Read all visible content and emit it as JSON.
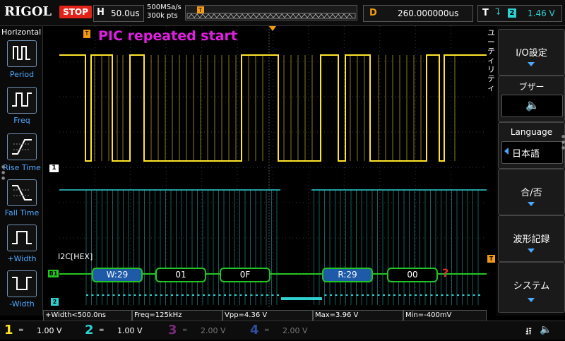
{
  "topbar": {
    "brand": "RIGOL",
    "run_state": "STOP",
    "horizontal_key": "H",
    "timebase": "50.0us",
    "sample_rate": "500MSa/s",
    "memory_depth": "300k pts",
    "delay_key": "D",
    "delay_value": "260.000000us",
    "trigger_key": "T",
    "trigger_source": "2",
    "trigger_level": "1.46 V"
  },
  "left_menu": {
    "title": "Horizontal",
    "items": [
      {
        "label": "Period",
        "icon": "period-icon"
      },
      {
        "label": "Freq",
        "icon": "freq-icon"
      },
      {
        "label": "Rise Time",
        "icon": "rise-time-icon"
      },
      {
        "label": "Fall Time",
        "icon": "fall-time-icon"
      },
      {
        "label": "+Width",
        "icon": "pos-width-icon"
      },
      {
        "label": "-Width",
        "icon": "neg-width-icon"
      }
    ]
  },
  "screen": {
    "annotation": "PIC repeated start",
    "channel_marker_1": "1",
    "bus_marker": "B1",
    "bus_label": "I2C[HEX]",
    "trigger_marker": "T",
    "decode_packets": [
      {
        "text": "W:29",
        "type": "address"
      },
      {
        "text": "01",
        "type": "data"
      },
      {
        "text": "0F",
        "type": "data"
      },
      {
        "text": "R:29",
        "type": "address"
      },
      {
        "text": "00",
        "type": "data"
      }
    ],
    "unknown_mark": "?"
  },
  "utility_tab": "ユーティリティ",
  "right_menu": {
    "io_settings": "I/O設定",
    "buzzer_title": "ブザー",
    "language_title": "Language",
    "language_value": "日本語",
    "pass_fail": "合/否",
    "waveform_record": "波形記録",
    "system": "システム"
  },
  "measurements": {
    "width": "+Width<500.0ns",
    "freq": "Freq=125kHz",
    "vpp": "Vpp=4.36 V",
    "max": "Max=3.96 V",
    "min": "Min=-400mV"
  },
  "channels": [
    {
      "num": "1",
      "coupling": "=",
      "scale": "1.00 V",
      "color": "#ffe42a"
    },
    {
      "num": "2",
      "coupling": "=",
      "scale": "1.00 V",
      "color": "#2fd0d0"
    },
    {
      "num": "3",
      "coupling": "=",
      "scale": "2.00 V",
      "color": "#c040c0"
    },
    {
      "num": "4",
      "coupling": "=",
      "scale": "2.00 V",
      "color": "#3d6bd6"
    }
  ],
  "colors": {
    "ch1": "#ffe42a",
    "ch2": "#2fd0d0",
    "bus": "#22c522",
    "address_fill": "#1e5aa8",
    "annotation": "#e020e0",
    "accent": "#f39c12"
  }
}
